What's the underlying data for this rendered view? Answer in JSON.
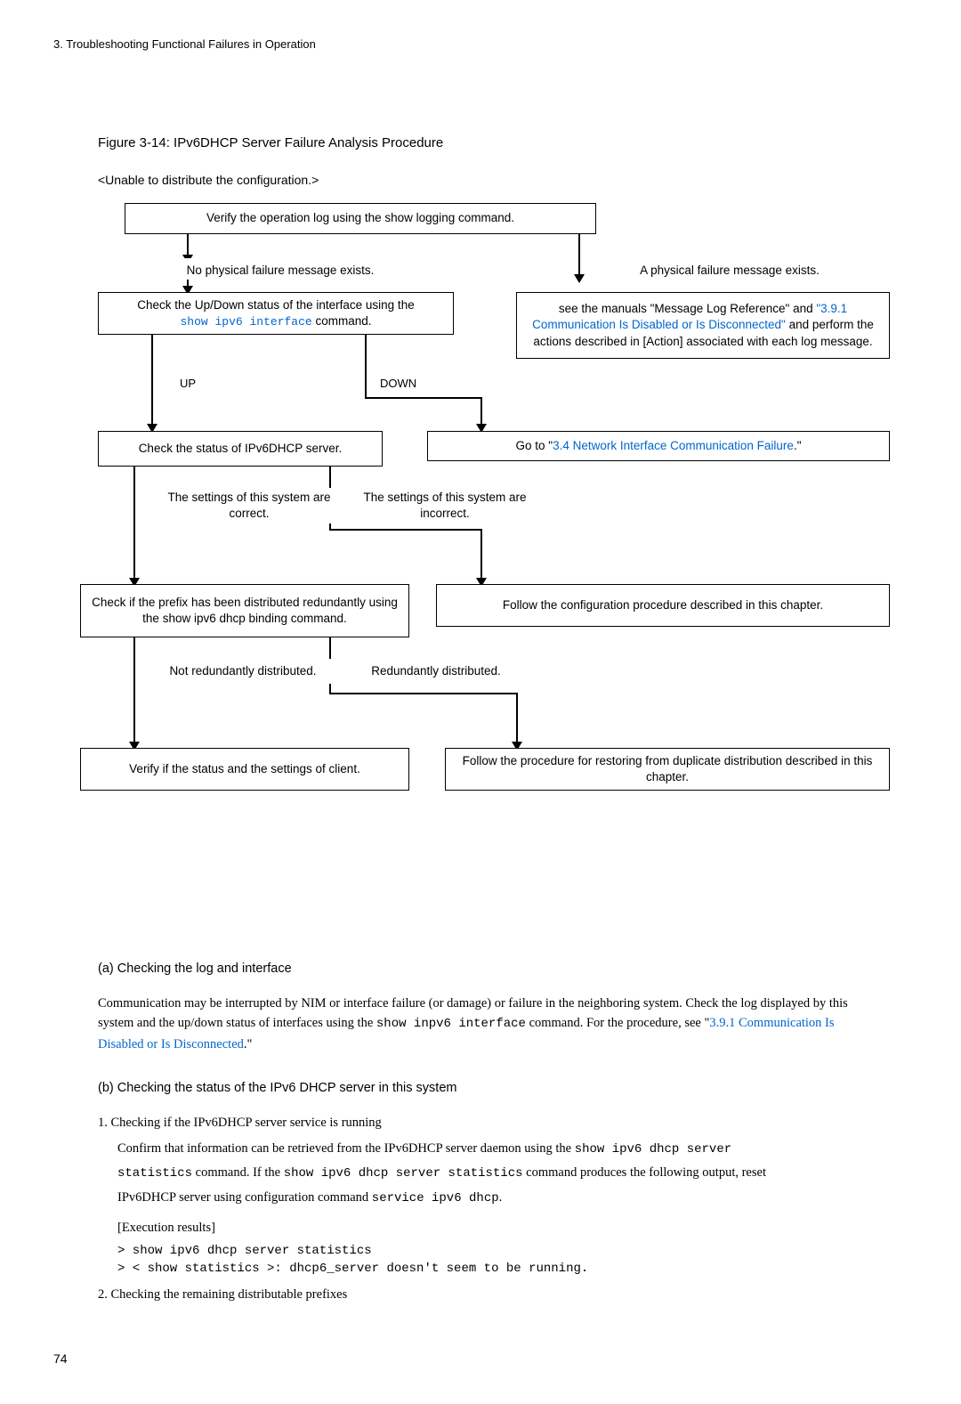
{
  "header": "3.  Troubleshooting Functional Failures in Operation",
  "figure_title": "Figure 3-14: IPv6DHCP Server Failure Analysis Procedure",
  "subtitle": "<Unable to distribute the configuration.>",
  "flowchart": {
    "box1": "Verify the operation log using the show logging command.",
    "box2a": "No physical failure message exists.",
    "box2b": "A physical failure message exists.",
    "box3a_pre": "Check the Up/Down status of the interface using the",
    "box3a_cmd": "show ipv6 interface",
    "box3a_post": " command.",
    "box3b_pre": "see the manuals \"Message Log Reference\" and ",
    "box3b_link": "\"3.9.1 Communication Is Disabled or Is Disconnected\"",
    "box3b_post": " and perform the actions described in [Action] associated with each log message.",
    "label_up": "UP",
    "label_down": "DOWN",
    "box4a": "Check the status of IPv6DHCP server.",
    "box4b_pre": "Go to \"",
    "box4b_link": "3.4 Network Interface Communication Failure",
    "box4b_post": ".\"",
    "box5a": "The settings of this system are correct.",
    "box5b": "The settings of this system are incorrect.",
    "box6a": "Check if the prefix has been distributed redundantly using the show ipv6 dhcp binding command.",
    "box6b": "Follow the configuration procedure described in this chapter.",
    "box7a": "Not redundantly distributed.",
    "box7b": "Redundantly distributed.",
    "box8a": "Verify if the status and the settings of client.",
    "box8b": "Follow the procedure for restoring from duplicate distribution described in this chapter."
  },
  "section_a_heading": "(a)   Checking the log and interface",
  "section_a_text_pre": "Communication may be interrupted by NIM or interface failure (or damage) or failure in the neighboring system. Check the log displayed by this system and the up/down status of interfaces using the ",
  "section_a_cmd": "show inpv6 interface",
  "section_a_text_mid": " command. For the procedure, see \"",
  "section_a_link": "3.9.1 Communication Is Disabled or Is Disconnected",
  "section_a_text_post": ".\"",
  "section_b_heading": "(b)   Checking the status of the IPv6 DHCP server in this system",
  "list1_num": "1.  Checking if the IPv6DHCP server service is running",
  "list1_line1_pre": "Confirm that information can be retrieved from the IPv6DHCP server daemon using the ",
  "list1_line1_cmd": "show ipv6 dhcp server",
  "list1_line2_cmd1": "statistics",
  "list1_line2_mid": " command. If the ",
  "list1_line2_cmd2": "show ipv6 dhcp server statistics",
  "list1_line2_post": " command produces the following output, reset",
  "list1_line3_pre": "IPv6DHCP server using configuration command ",
  "list1_line3_cmd": "service ipv6 dhcp",
  "list1_line3_post": ".",
  "exec_label": "[Execution results]",
  "code_line1": "> show ipv6 dhcp server statistics",
  "code_line2": "> < show statistics >: dhcp6_server doesn't seem to be running.",
  "list2_num": "2.  Checking the remaining distributable prefixes",
  "page_num": "74"
}
